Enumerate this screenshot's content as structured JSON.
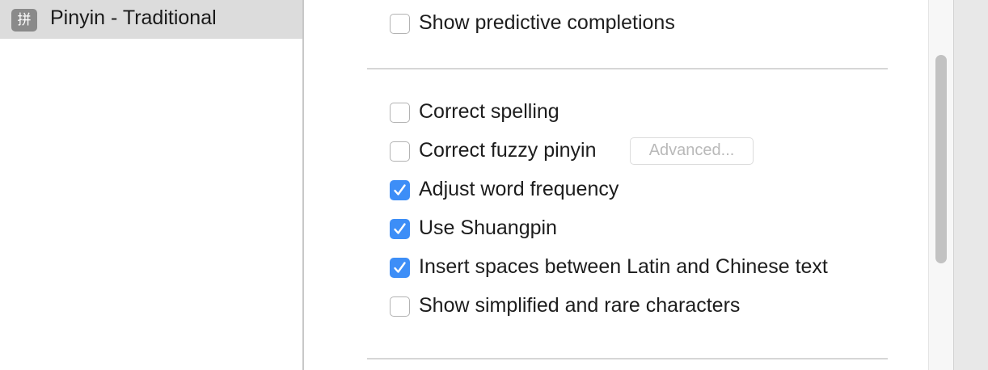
{
  "sources": {
    "selected": {
      "badge": "拼",
      "label": "Pinyin - Traditional"
    }
  },
  "options": {
    "predictive": {
      "label": "Show predictive completions",
      "checked": false
    },
    "correct_spelling": {
      "label": "Correct spelling",
      "checked": false
    },
    "fuzzy_pinyin": {
      "label": "Correct fuzzy pinyin",
      "checked": false
    },
    "advanced_label": "Advanced...",
    "word_frequency": {
      "label": "Adjust word frequency",
      "checked": true
    },
    "shuangpin": {
      "label": "Use Shuangpin",
      "checked": true
    },
    "insert_spaces": {
      "label": "Insert spaces between Latin and Chinese text",
      "checked": true
    },
    "simplified_rare": {
      "label": "Show simplified and rare characters",
      "checked": false
    }
  },
  "colors": {
    "checkbox_checked": "#3d8ef7",
    "selection_bg": "#dcdcdc",
    "disabled_text": "#b9b9b9"
  },
  "icons": {
    "source_badge": "pinyin-badge-icon",
    "check": "checkmark-icon"
  }
}
